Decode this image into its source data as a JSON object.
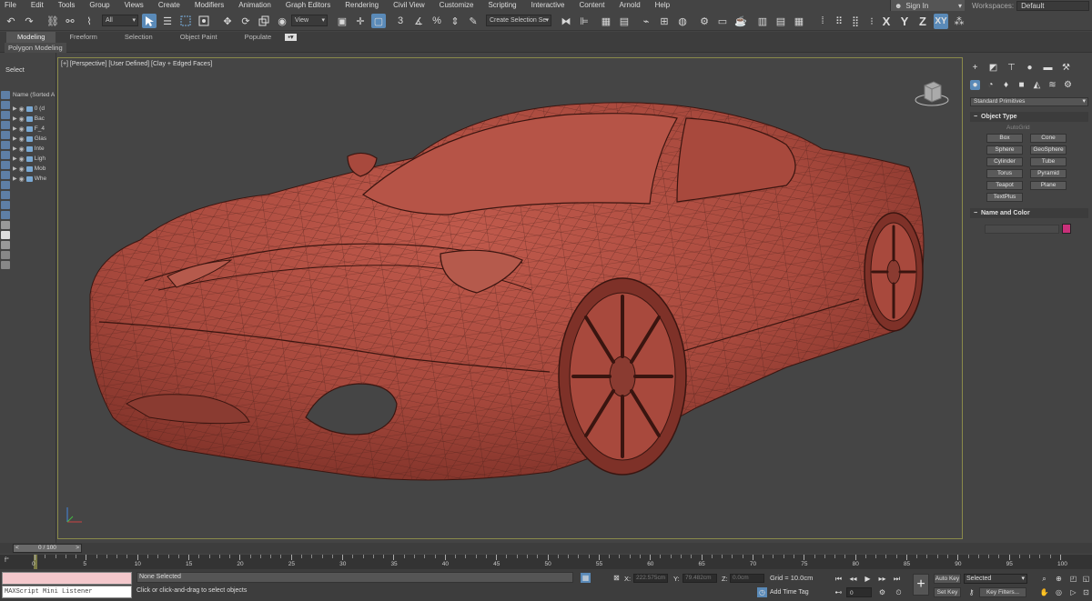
{
  "menu": {
    "items": [
      "File",
      "Edit",
      "Tools",
      "Group",
      "Views",
      "Create",
      "Modifiers",
      "Animation",
      "Graph Editors",
      "Rendering",
      "Civil View",
      "Customize",
      "Scripting",
      "Interactive",
      "Content",
      "Arnold",
      "Help"
    ],
    "sign_in": "Sign In",
    "workspaces_label": "Workspaces:",
    "workspaces_value": "Default"
  },
  "toolbar": {
    "selection_filter": "All",
    "ref_coord": "View",
    "named_selection": "Create Selection Se",
    "axis_x": "X",
    "axis_y": "Y",
    "axis_z": "Z",
    "axis_xy": "XY"
  },
  "ribbon": {
    "tabs": [
      "Modeling",
      "Freeform",
      "Selection",
      "Object Paint",
      "Populate"
    ],
    "sub": "Polygon Modeling"
  },
  "explorer": {
    "select_label": "Select",
    "header": "Name (Sorted A",
    "rows": [
      "0 (d",
      "Bac",
      "F_4",
      "Glas",
      "Inte",
      "Ligh",
      "Mob",
      "Whe"
    ]
  },
  "viewport": {
    "label": "[+] [Perspective] [User Defined] [Clay + Edged Faces]",
    "car_color": "#a8493d",
    "wire_color": "#4a1f1a"
  },
  "command_panel": {
    "category": "Standard Primitives",
    "object_type_title": "Object Type",
    "autogrid": "AutoGrid",
    "primitives": [
      "Box",
      "Cone",
      "Sphere",
      "GeoSphere",
      "Cylinder",
      "Tube",
      "Torus",
      "Pyramid",
      "Teapot",
      "Plane",
      "TextPlus"
    ],
    "name_color_title": "Name and Color",
    "object_color": "#c9307a"
  },
  "timeline": {
    "frame_display": "0 / 100",
    "ticks": [
      "0",
      "5",
      "10",
      "15",
      "20",
      "25",
      "30",
      "35",
      "40",
      "45",
      "50",
      "55",
      "60",
      "65",
      "70",
      "75",
      "80",
      "85",
      "90",
      "95",
      "100"
    ]
  },
  "status": {
    "maxscript": "MAXScript Mini Listener",
    "selection": "None Selected",
    "prompt": "Click or click-and-drag to select objects",
    "x_label": "X:",
    "x_value": "222.575cm",
    "y_label": "Y:",
    "y_value": "79.482cm",
    "z_label": "Z:",
    "z_value": "0.0cm",
    "grid": "Grid = 10.0cm",
    "add_time_tag": "Add Time Tag",
    "auto_key": "Auto Key",
    "set_key": "Set Key",
    "selected": "Selected",
    "key_filters": "Key Filters...",
    "frame": "0"
  }
}
